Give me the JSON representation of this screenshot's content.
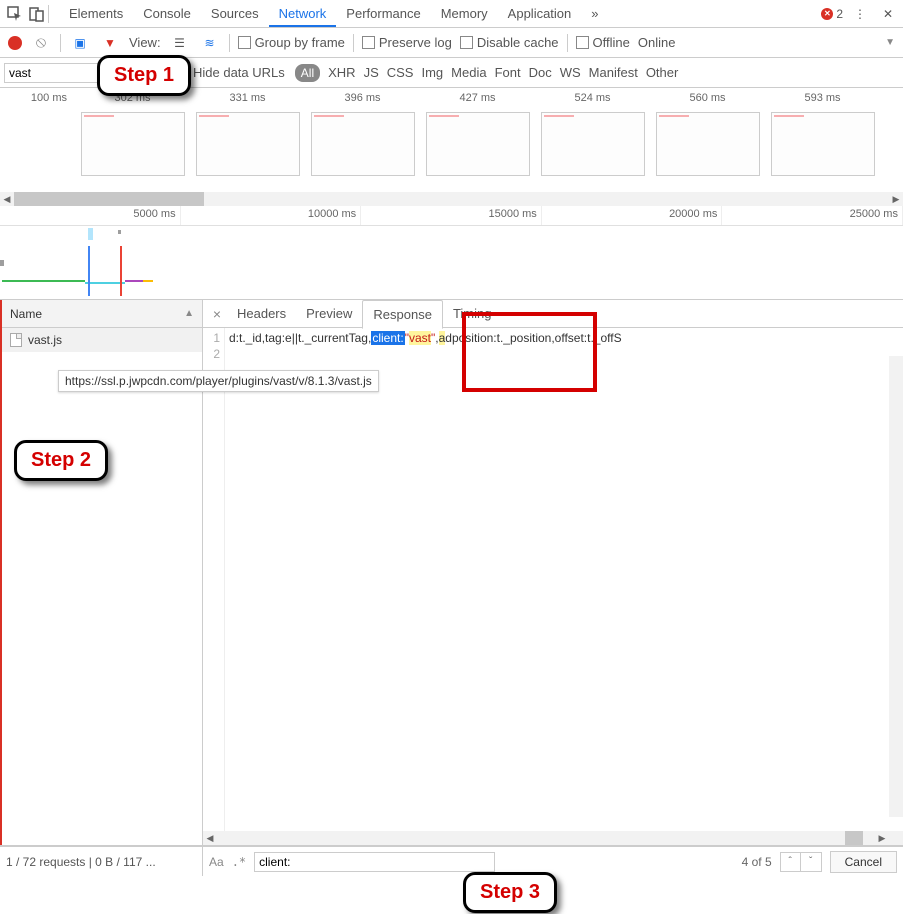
{
  "main_tabs": {
    "elements": "Elements",
    "console": "Console",
    "sources": "Sources",
    "network": "Network",
    "performance": "Performance",
    "memory": "Memory",
    "application": "Application"
  },
  "error_count": "2",
  "toolbar": {
    "view_label": "View:",
    "group_by_frame": "Group by frame",
    "preserve_log": "Preserve log",
    "disable_cache": "Disable cache",
    "offline": "Offline",
    "online": "Online"
  },
  "filter": {
    "value": "vast",
    "hide_data_urls": "Hide data URLs",
    "categories": {
      "all": "All",
      "xhr": "XHR",
      "js": "JS",
      "css": "CSS",
      "img": "Img",
      "media": "Media",
      "font": "Font",
      "doc": "Doc",
      "ws": "WS",
      "manifest": "Manifest",
      "other": "Other"
    }
  },
  "thumb_ticks": [
    "100 ms",
    "302 ms",
    "331 ms",
    "396 ms",
    "427 ms",
    "524 ms",
    "560 ms",
    "593 ms"
  ],
  "overview_ticks": [
    "5000 ms",
    "10000 ms",
    "15000 ms",
    "20000 ms",
    "25000 ms"
  ],
  "name_header": "Name",
  "file": {
    "name": "vast.js",
    "tooltip": "https://ssl.p.jwpcdn.com/player/plugins/vast/v/8.1.3/vast.js"
  },
  "sub_tabs": {
    "headers": "Headers",
    "preview": "Preview",
    "response": "Response",
    "timing": "Timing"
  },
  "code": {
    "line1_num": "1",
    "line2_num": "2",
    "seg_a": "d:t._id,tag:e||t._currentTag,",
    "seg_client": "client:",
    "seg_vast_q1": "\"",
    "seg_vast": "vast",
    "seg_vast_q2": "\"",
    "seg_comma": ",",
    "seg_adpos_a": "a",
    "seg_adpos": "dposition:t._position,offset:t._offS"
  },
  "status": "1 / 72 requests  |  0 B / 117 ...",
  "search": {
    "value": "client:",
    "match": "4 of 5",
    "cancel": "Cancel",
    "aa": "Aa",
    "regex": ".*"
  },
  "steps": {
    "s1": "Step 1",
    "s2": "Step 2",
    "s3": "Step 3"
  }
}
